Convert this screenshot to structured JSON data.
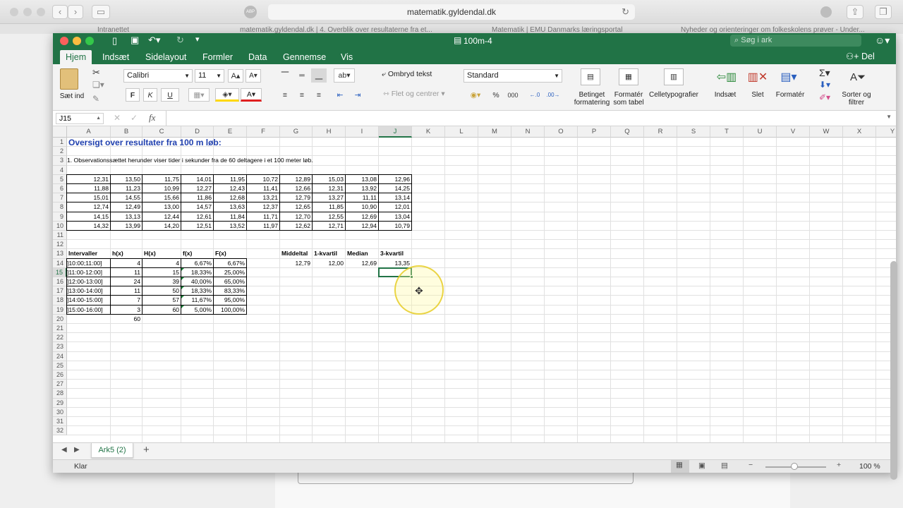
{
  "browser": {
    "url": "matematik.gyldendal.dk",
    "adblock_badge": "ABP",
    "bookmarks": [
      "Intranettet",
      "matematik.gyldendal.dk | 4. Overblik over resultaterne fra et...",
      "Matematik | EMU Danmarks læringsportal",
      "Nyheder og orienteringer om folkeskolens prøver - Under..."
    ]
  },
  "excel": {
    "window_title": "100m-4",
    "search_placeholder": "Søg i ark",
    "share_label": "Del",
    "tabs": [
      "Hjem",
      "Indsæt",
      "Sidelayout",
      "Formler",
      "Data",
      "Gennemse",
      "Vis"
    ],
    "active_tab": "Hjem",
    "ribbon": {
      "paste_label": "Sæt ind",
      "font_name": "Calibri",
      "font_size": "11",
      "bold": "F",
      "italic": "K",
      "underline": "U",
      "wrap_text": "Ombryd tekst",
      "merge_center": "Flet og centrer",
      "number_format": "Standard",
      "percent": "%",
      "thousands": "000",
      "cond_format": "Betinget formatering",
      "format_table": "Formatér som tabel",
      "cell_styles": "Celletypografier",
      "insert": "Indsæt",
      "delete": "Slet",
      "format": "Formatér",
      "sort_filter": "Sorter og filtrer"
    },
    "name_box": "J15",
    "fx_label": "fx",
    "formula_value": "",
    "columns": [
      "A",
      "B",
      "C",
      "D",
      "E",
      "F",
      "G",
      "H",
      "I",
      "J",
      "K",
      "L",
      "M",
      "N",
      "O",
      "P",
      "Q",
      "R",
      "S",
      "T",
      "U",
      "V",
      "W",
      "X",
      "Y"
    ],
    "selected_column": "J",
    "selected_row": 15,
    "title_cell": "Oversigt over resultater fra 100 m løb:",
    "description": "1. Observationssættet herunder viser tider i sekunder fra de 60 deltagere i et 100 meter løb.",
    "observations": [
      [
        "12,31",
        "13,50",
        "11,75",
        "14,01",
        "11,95",
        "10,72",
        "12,89",
        "15,03",
        "13,08",
        "12,96"
      ],
      [
        "11,88",
        "11,23",
        "10,99",
        "12,27",
        "12,43",
        "11,41",
        "12,66",
        "12,31",
        "13,92",
        "14,25"
      ],
      [
        "15,01",
        "14,55",
        "15,66",
        "11,86",
        "12,68",
        "13,21",
        "12,79",
        "13,27",
        "11,11",
        "13,14"
      ],
      [
        "12,74",
        "12,49",
        "13,00",
        "14,57",
        "13,63",
        "12,37",
        "12,65",
        "11,85",
        "10,90",
        "12,01"
      ],
      [
        "14,15",
        "13,13",
        "12,44",
        "12,61",
        "11,84",
        "11,71",
        "12,70",
        "12,55",
        "12,69",
        "13,04"
      ],
      [
        "14,32",
        "13,99",
        "14,20",
        "12,51",
        "13,52",
        "11,97",
        "12,62",
        "12,71",
        "12,94",
        "10,79"
      ]
    ],
    "freq_headers": [
      "Intervaller",
      "h(x)",
      "H(x)",
      "f(x)",
      "F(x)"
    ],
    "freq_rows": [
      [
        "]10:00;11:00]",
        "4",
        "4",
        "6,67%",
        "6,67%"
      ],
      [
        "]11:00-12:00]",
        "11",
        "15",
        "18,33%",
        "25,00%"
      ],
      [
        "]12:00-13:00]",
        "24",
        "39",
        "40,00%",
        "65,00%"
      ],
      [
        "]13:00-14:00]",
        "11",
        "50",
        "18,33%",
        "83,33%"
      ],
      [
        "]14:00-15:00]",
        "7",
        "57",
        "11,67%",
        "95,00%"
      ],
      [
        "]15:00-16:00]",
        "3",
        "60",
        "5,00%",
        "100,00%"
      ]
    ],
    "freq_total": "60",
    "stats_headers": [
      "Middeltal",
      "1-kvartil",
      "Median",
      "3-kvartil"
    ],
    "stats_values": [
      "12,79",
      "12,00",
      "12,69",
      "13,35"
    ],
    "row_count": 32,
    "sheet_tab": "Ark5 (2)",
    "status": "Klar",
    "zoom": "100 %"
  }
}
